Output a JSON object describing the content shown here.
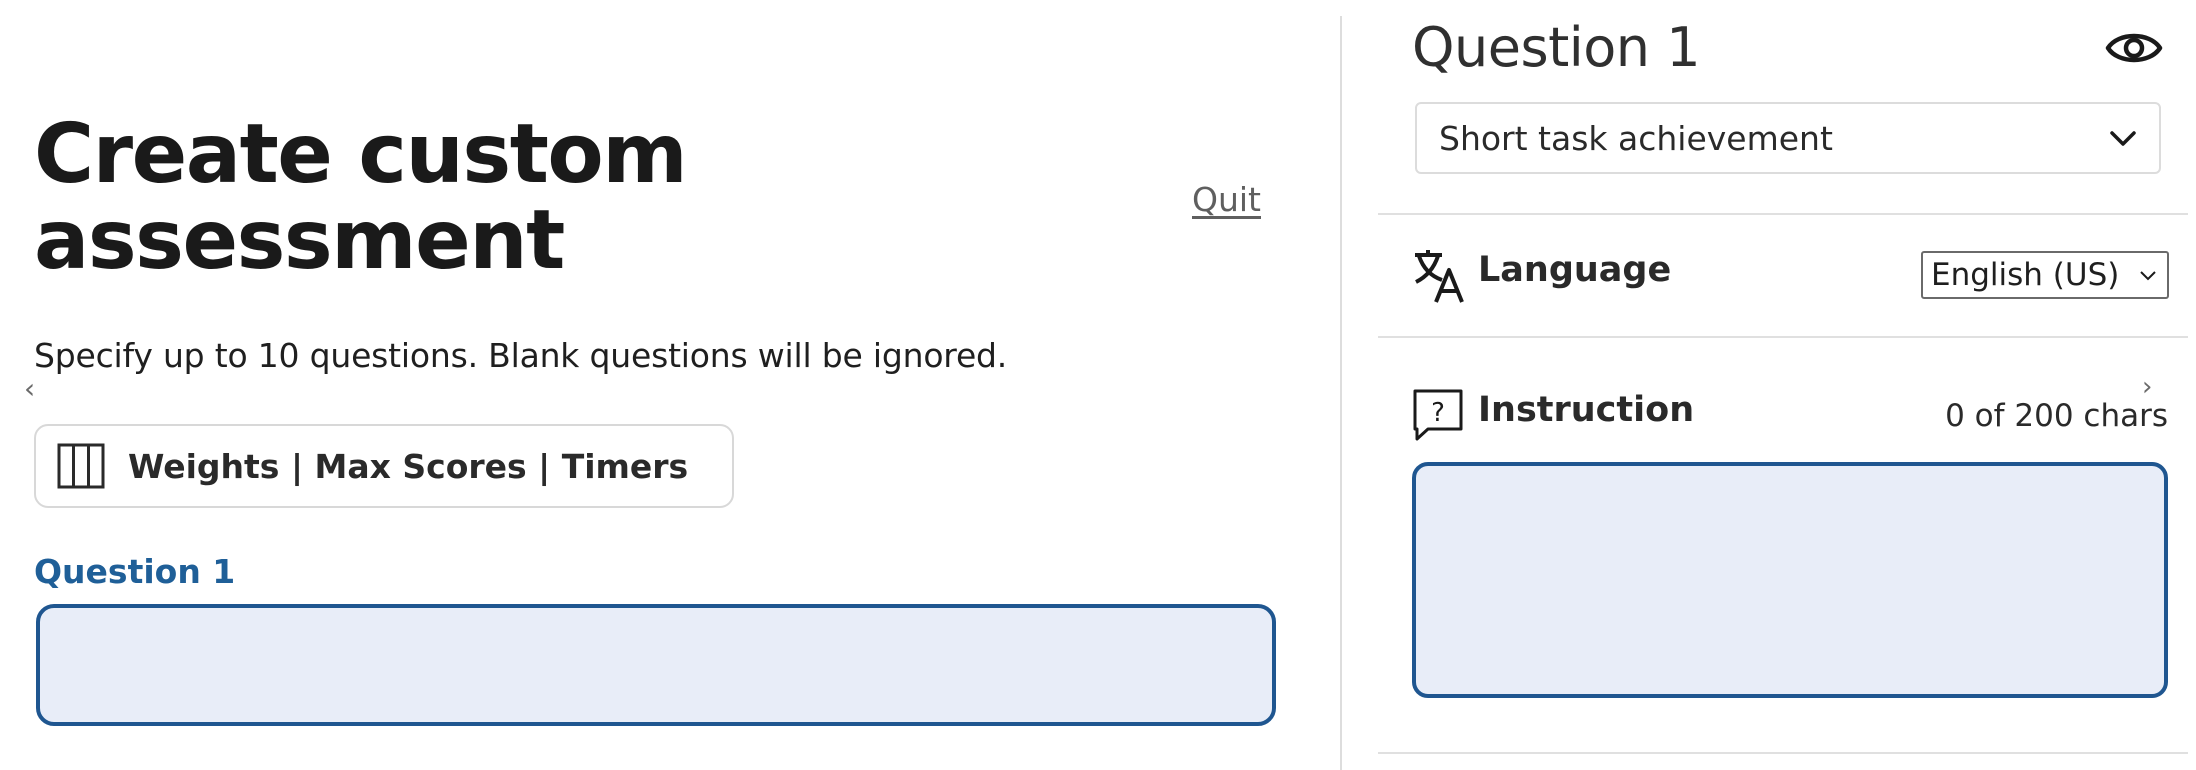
{
  "left": {
    "title_line1": "Create custom",
    "title_line2": "assessment",
    "quit_label": "Quit",
    "subtitle": "Specify up to 10 questions. Blank questions will be ignored.",
    "weights_button_label": "Weights | Max Scores | Timers",
    "question_label": "Question 1",
    "question_value": ""
  },
  "right": {
    "title": "Question 1",
    "question_type": "Short task achievement",
    "language_label": "Language",
    "language_value": "English (US)",
    "instruction_label": "Instruction",
    "instruction_count": "0 of 200 chars",
    "instruction_value": ""
  },
  "icons": {
    "prev": "chevron-left-icon",
    "next": "chevron-right-icon",
    "preview": "eye-icon",
    "columns": "columns-icon",
    "translate": "translate-icon",
    "help": "question-bubble-icon",
    "dropdown": "chevron-down-icon"
  },
  "colors": {
    "accent": "#1f5690",
    "label_blue": "#1f5f98",
    "input_bg": "#e8edf8"
  }
}
